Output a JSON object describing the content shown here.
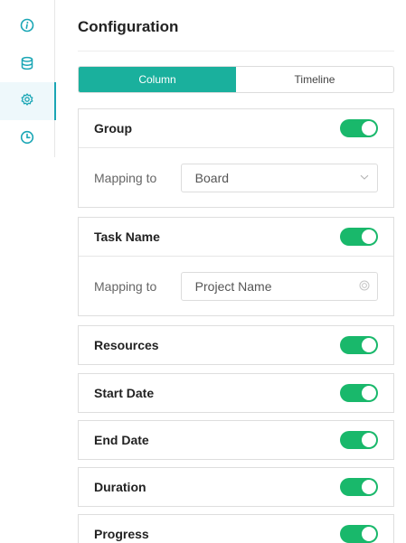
{
  "sidebar": {
    "items": [
      {
        "icon": "info-icon"
      },
      {
        "icon": "database-icon"
      },
      {
        "icon": "gear-icon",
        "active": true
      },
      {
        "icon": "clock-icon"
      }
    ]
  },
  "header": {
    "title": "Configuration"
  },
  "view_tabs": [
    {
      "label": "Column",
      "active": true
    },
    {
      "label": "Timeline",
      "active": false
    }
  ],
  "fields": [
    {
      "label": "Group",
      "enabled": true,
      "mapping_label": "Mapping to",
      "mapping_value": "Board",
      "mapping_icon": "chevron-down-icon"
    },
    {
      "label": "Task Name",
      "enabled": true,
      "mapping_label": "Mapping to",
      "mapping_value": "Project Name",
      "mapping_icon": "clear-icon"
    },
    {
      "label": "Resources",
      "enabled": true
    },
    {
      "label": "Start Date",
      "enabled": true
    },
    {
      "label": "End Date",
      "enabled": true
    },
    {
      "label": "Duration",
      "enabled": true
    },
    {
      "label": "Progress",
      "enabled": true
    }
  ],
  "colors": {
    "accent": "#1ab09d",
    "toggle_on": "#19b86b",
    "rail_icon": "#1aa6b5"
  }
}
